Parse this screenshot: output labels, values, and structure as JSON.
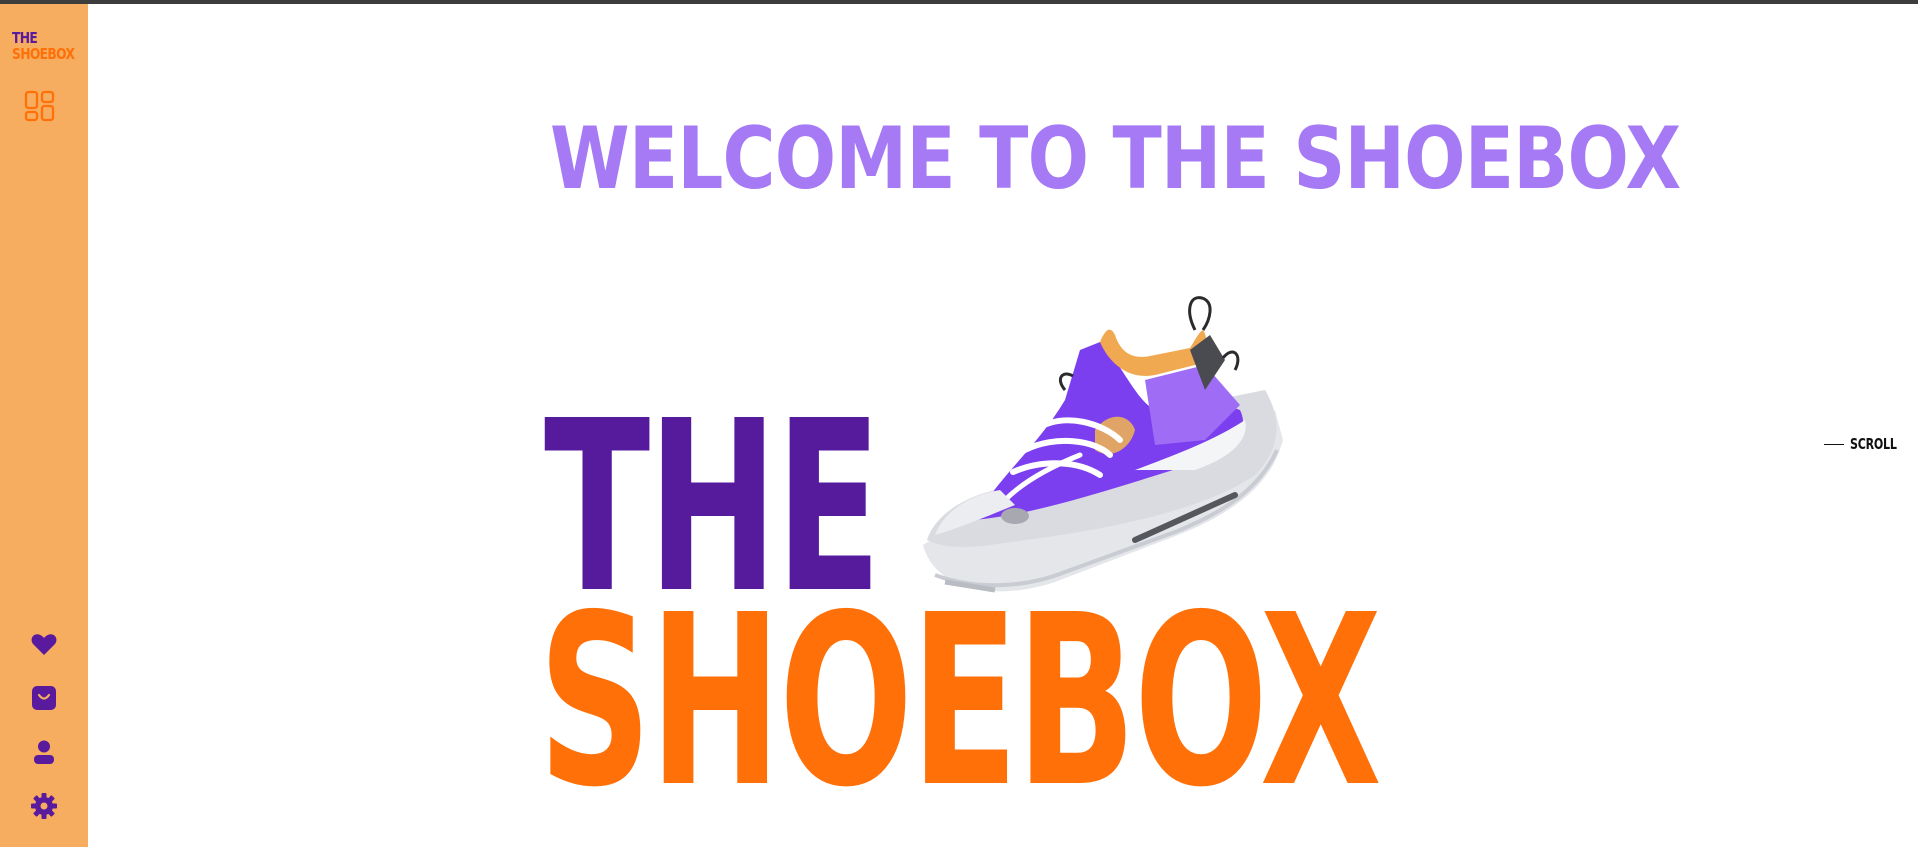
{
  "sidebar": {
    "logo_line1": "THE",
    "logo_line2": "SHOEBOX",
    "top_icon": "dashboard-icon",
    "bottom_icons": [
      "heart-icon",
      "shopping-bag-icon",
      "user-icon",
      "gear-icon"
    ]
  },
  "hero": {
    "welcome_title": "WELCOME TO THE SHOEBOX",
    "brand_line1": "THE",
    "brand_line2": "SHOEBOX",
    "illustration": "sneaker-illustration"
  },
  "scroll_hint": {
    "label": "SCROLL"
  },
  "colors": {
    "sidebar_bg": "#f6ad5f",
    "brand_purple": "#561b9c",
    "brand_orange": "#ff7009",
    "title_lavender": "#a679f5"
  }
}
